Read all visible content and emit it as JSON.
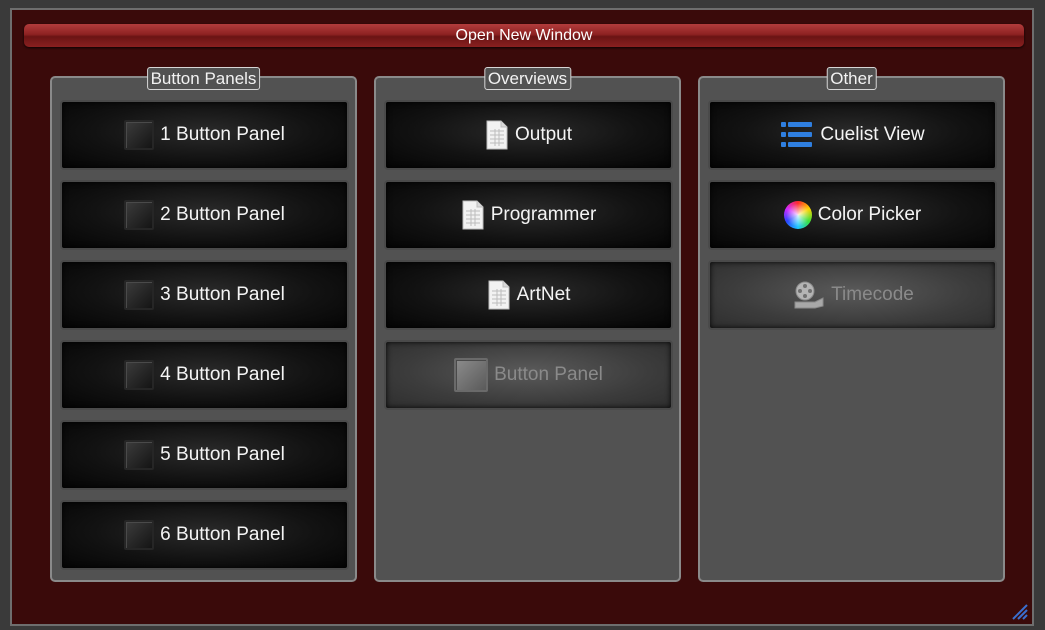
{
  "window": {
    "title": "Open New Window"
  },
  "groups": [
    {
      "label": "Button Panels",
      "buttons": [
        {
          "label": "1 Button Panel",
          "icon": "panel-icon",
          "enabled": true
        },
        {
          "label": "2 Button Panel",
          "icon": "panel-icon",
          "enabled": true
        },
        {
          "label": "3 Button Panel",
          "icon": "panel-icon",
          "enabled": true
        },
        {
          "label": "4 Button Panel",
          "icon": "panel-icon",
          "enabled": true
        },
        {
          "label": "5 Button Panel",
          "icon": "panel-icon",
          "enabled": true
        },
        {
          "label": "6 Button Panel",
          "icon": "panel-icon",
          "enabled": true
        }
      ]
    },
    {
      "label": "Overviews",
      "buttons": [
        {
          "label": "Output",
          "icon": "document-icon",
          "enabled": true
        },
        {
          "label": "Programmer",
          "icon": "document-icon",
          "enabled": true
        },
        {
          "label": "ArtNet",
          "icon": "document-icon",
          "enabled": true
        },
        {
          "label": "Button Panel",
          "icon": "panel-icon",
          "enabled": false
        }
      ]
    },
    {
      "label": "Other",
      "buttons": [
        {
          "label": "Cuelist View",
          "icon": "list-icon",
          "enabled": true
        },
        {
          "label": "Color Picker",
          "icon": "color-wheel-icon",
          "enabled": true
        },
        {
          "label": "Timecode",
          "icon": "film-reel-icon",
          "enabled": false
        }
      ]
    }
  ],
  "colors": {
    "window_bg": "#3a0a0a",
    "titlebar": "#8e2222",
    "group_bg": "#525252",
    "button_bg": "#121212",
    "list_icon": "#2f7fe0"
  }
}
